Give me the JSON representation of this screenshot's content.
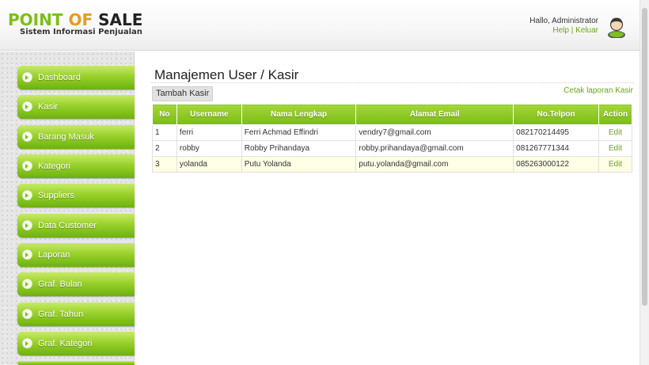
{
  "header": {
    "logo_word1": "POINT",
    "logo_word2": "OF",
    "logo_word3": "SALE",
    "logo_subtitle": "Sistem Informasi Penjualan",
    "greeting": "Hallo, Administrator",
    "help_link": "Help",
    "separator": "|",
    "logout_link": "Keluar"
  },
  "sidebar": {
    "items": [
      {
        "label": "Dashboard"
      },
      {
        "label": "Kasir"
      },
      {
        "label": "Barang Masuk"
      },
      {
        "label": "Kategori"
      },
      {
        "label": "Suppliers"
      },
      {
        "label": "Data Customer"
      },
      {
        "label": "Laporan"
      },
      {
        "label": "Graf. Bulan"
      },
      {
        "label": "Graf. Tahun"
      },
      {
        "label": "Graf. Kategori"
      }
    ]
  },
  "main": {
    "title": "Manajemen User / Kasir",
    "add_button": "Tambah Kasir",
    "print_link": "Cetak laporan Kasir",
    "columns": [
      "No",
      "Username",
      "Nama Lengkap",
      "Alamat Email",
      "No.Telpon",
      "Action"
    ],
    "rows": [
      {
        "no": "1",
        "username": "ferri",
        "name": "Ferri Achmad Effindri",
        "email": "vendry7@gmail.com",
        "phone": "082170214495",
        "action": "Edit"
      },
      {
        "no": "2",
        "username": "robby",
        "name": "Robby Prihandaya",
        "email": "robby.prihandaya@gmail.com",
        "phone": "081267771344",
        "action": "Edit"
      },
      {
        "no": "3",
        "username": "yolanda",
        "name": "Putu Yolanda",
        "email": "putu.yolanda@gmail.com",
        "phone": "085263000122",
        "action": "Edit"
      }
    ]
  },
  "colors": {
    "accent_green": "#7bbd14",
    "logo_orange": "#e59c1e",
    "link_green": "#6aa517"
  }
}
